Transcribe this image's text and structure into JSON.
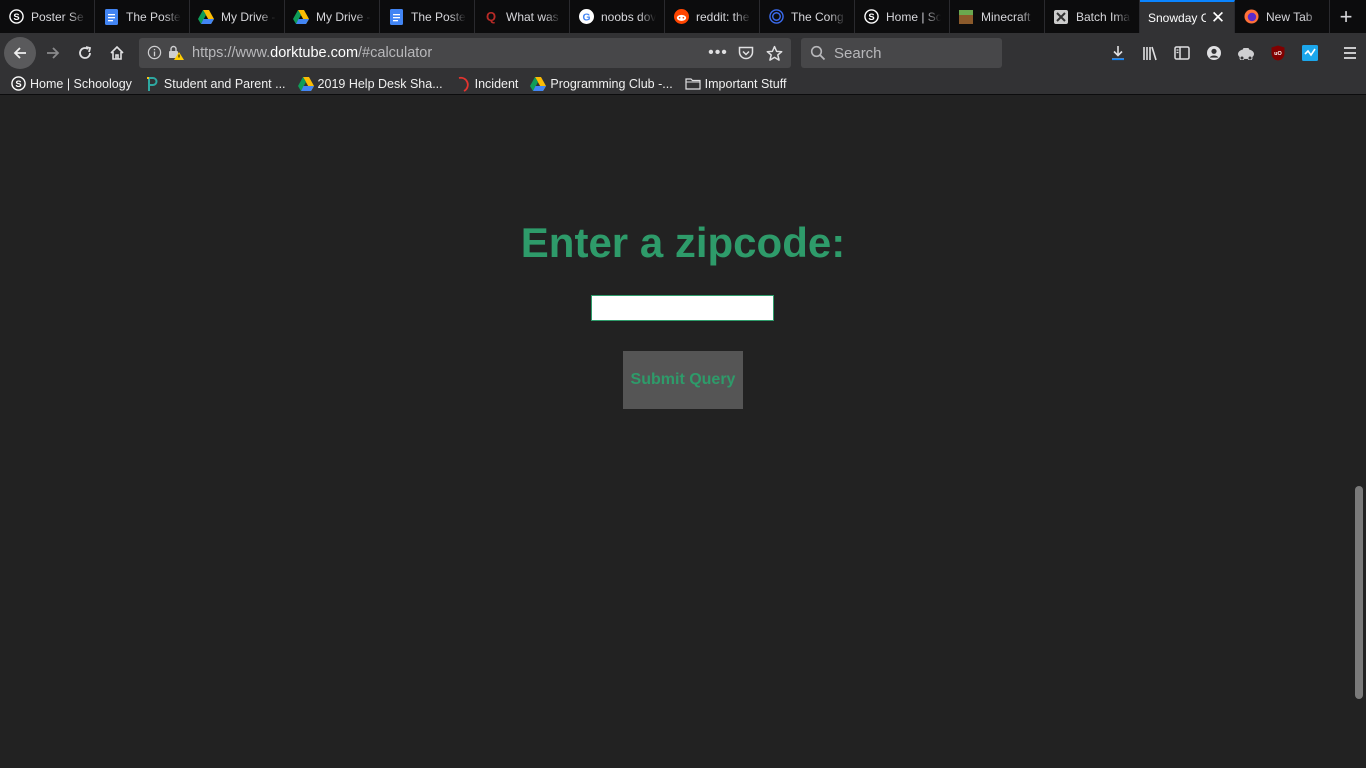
{
  "tabs": [
    {
      "title": "Poster Se",
      "icon": "schoology-icon",
      "color": "#ffffff"
    },
    {
      "title": "The Poste",
      "icon": "google-docs-icon",
      "color": "#4285f4"
    },
    {
      "title": "My Drive -",
      "icon": "google-drive-icon",
      "color": "#fbbc04"
    },
    {
      "title": "My Drive -",
      "icon": "google-drive-icon",
      "color": "#fbbc04"
    },
    {
      "title": "The Poste",
      "icon": "google-docs-icon",
      "color": "#4285f4"
    },
    {
      "title": "What was",
      "icon": "quora-icon",
      "color": "#b92b27"
    },
    {
      "title": "noobs dov",
      "icon": "google-icon",
      "color": "#ea4335"
    },
    {
      "title": "reddit: the",
      "icon": "reddit-icon",
      "color": "#ff4500"
    },
    {
      "title": "The Cong",
      "icon": "congress-icon",
      "color": "#3b6cf0"
    },
    {
      "title": "Home | Sc",
      "icon": "schoology-icon",
      "color": "#ffffff"
    },
    {
      "title": "Minecraft",
      "icon": "minecraft-icon",
      "color": "#6aa84f"
    },
    {
      "title": "Batch Ima",
      "icon": "batch-image-icon",
      "color": "#cccccc"
    },
    {
      "title": "Snowday C",
      "icon": "",
      "color": "",
      "active": true
    },
    {
      "title": "New Tab",
      "icon": "firefox-icon",
      "color": "#ff7139"
    }
  ],
  "navbar": {
    "url_prefix": "https://www.",
    "url_domain": "dorktube.com",
    "url_suffix": "/#calculator",
    "search_placeholder": "Search"
  },
  "bookmarks": [
    {
      "label": "Home | Schoology",
      "icon": "schoology-icon"
    },
    {
      "label": "Student and Parent ...",
      "icon": "p-logo-icon"
    },
    {
      "label": "2019 Help Desk Sha...",
      "icon": "google-drive-icon"
    },
    {
      "label": "Incident",
      "icon": "incident-icon"
    },
    {
      "label": "Programming Club -...",
      "icon": "google-drive-icon"
    },
    {
      "label": "Important Stuff",
      "icon": "folder-icon"
    }
  ],
  "main": {
    "heading": "Enter a zipcode:",
    "zip_value": "",
    "submit_label": "Submit Query"
  },
  "colors": {
    "accent": "#2e9b6a",
    "page_bg": "#222222",
    "button_bg": "#555555"
  }
}
